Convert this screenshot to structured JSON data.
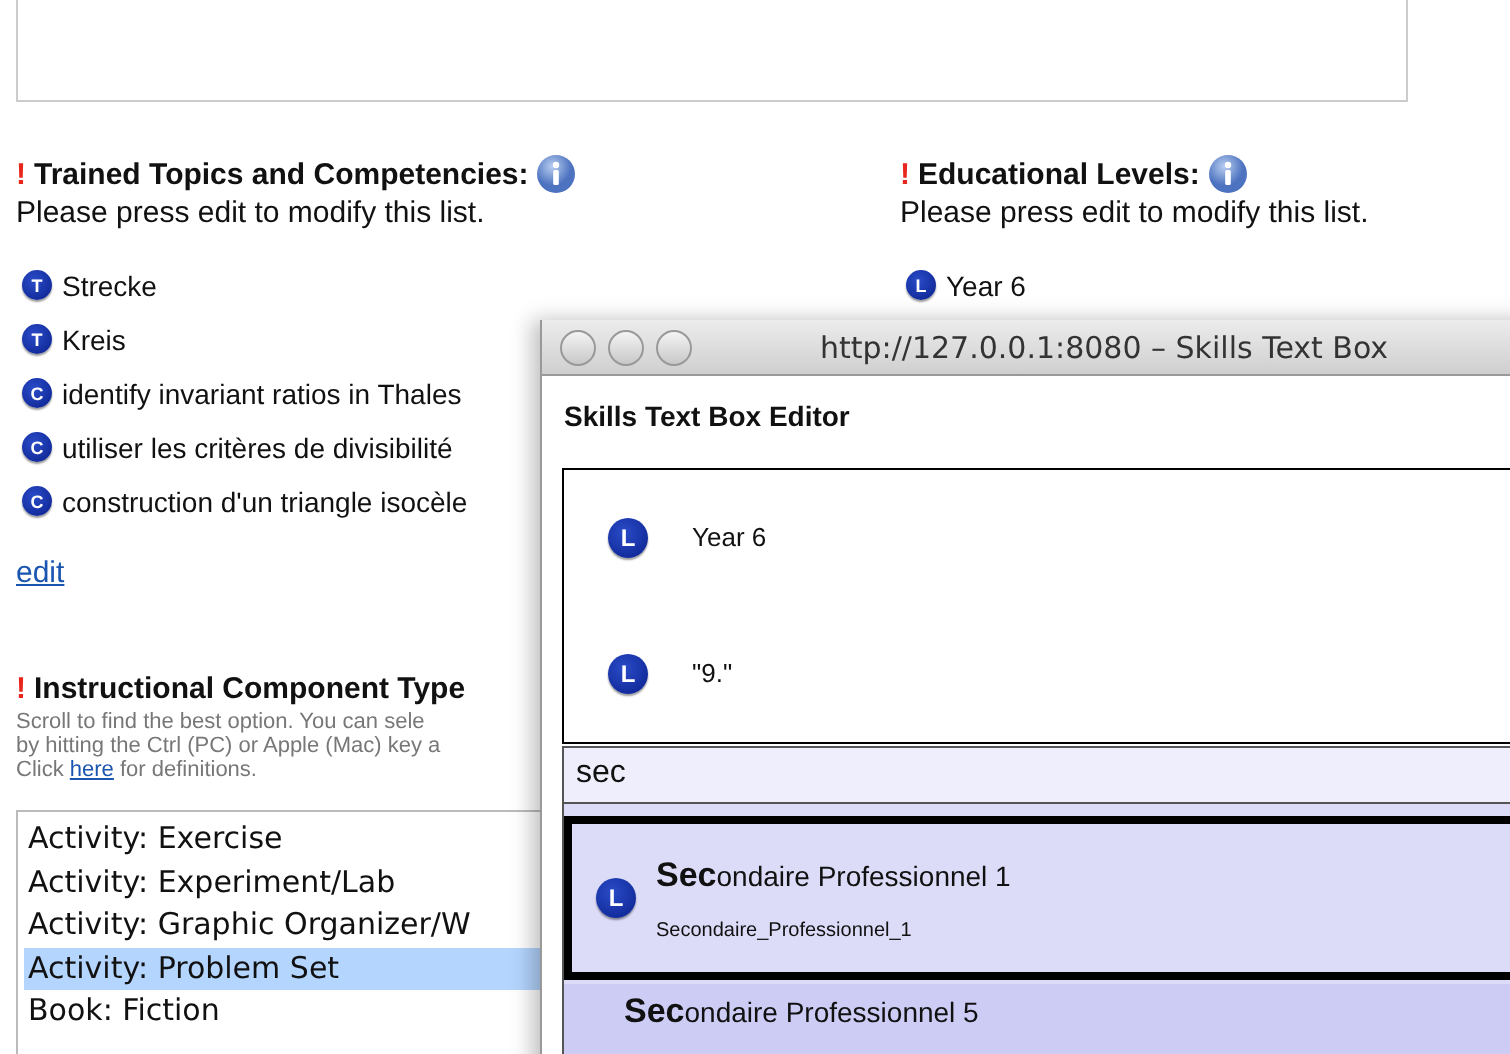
{
  "page": {
    "topics": {
      "marker": "!",
      "title": "Trained Topics and Competencies:",
      "hint": "Please press edit to modify this list.",
      "items": [
        {
          "badge": "T",
          "label": "Strecke"
        },
        {
          "badge": "T",
          "label": "Kreis"
        },
        {
          "badge": "C",
          "label": "identify invariant ratios in Thales"
        },
        {
          "badge": "C",
          "label": "utiliser les critères de divisibilité"
        },
        {
          "badge": "C",
          "label": "construction d'un triangle isocèle"
        }
      ],
      "edit_link": "edit"
    },
    "levels": {
      "marker": "!",
      "title": "Educational Levels:",
      "hint": "Please press edit to modify this list.",
      "items": [
        {
          "badge": "L",
          "label": "Year 6"
        }
      ]
    },
    "component_types": {
      "marker": "!",
      "title": "Instructional Component Type",
      "help_lines": [
        "Scroll to find the best option. You can sele",
        "by hitting the Ctrl (PC) or Apple (Mac) key a"
      ],
      "click_before": "Click",
      "link": "here",
      "click_after": "for definitions.",
      "options": [
        {
          "label": "Activity: Exercise",
          "selected": false
        },
        {
          "label": "Activity: Experiment/Lab",
          "selected": false
        },
        {
          "label": "Activity: Graphic Organizer/W",
          "selected": false
        },
        {
          "label": "Activity: Problem Set",
          "selected": true
        },
        {
          "label": "Book: Fiction",
          "selected": false
        }
      ]
    }
  },
  "popup": {
    "window_title": "http://127.0.0.1:8080 – Skills Text Box",
    "heading": "Skills Text Box Editor",
    "chosen": [
      {
        "badge": "L",
        "label": "Year 6"
      },
      {
        "badge": "L",
        "label": "\"9.\""
      }
    ],
    "search": {
      "value": "sec"
    },
    "suggestions": [
      {
        "badge": "L",
        "title": "**Sec**ondaire Professionnel 1",
        "subtitle": "Secondaire_Professionnel_1",
        "selected": true
      },
      {
        "title": "**Sec**ondaire Professionnel 5",
        "selected": false
      }
    ]
  }
}
